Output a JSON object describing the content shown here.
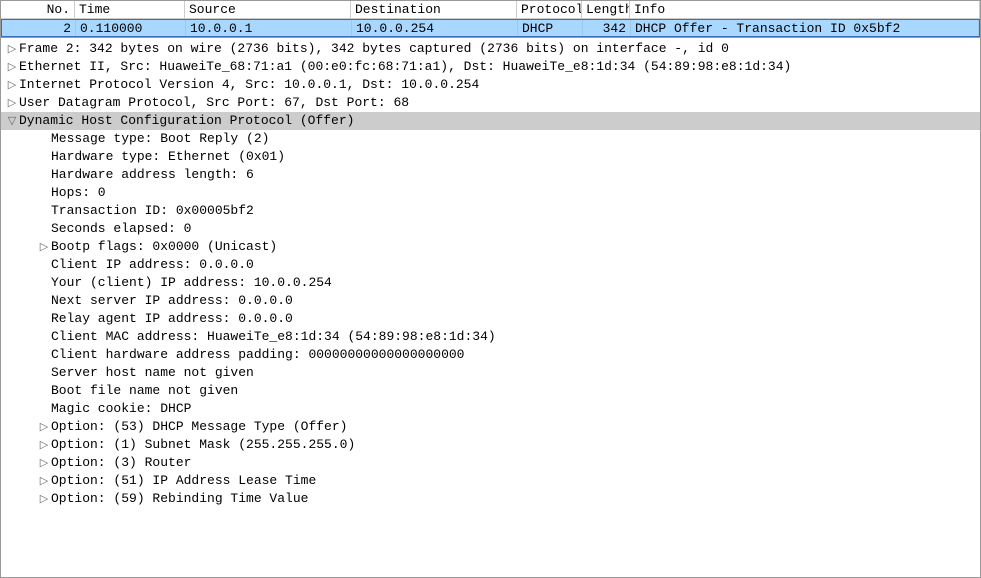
{
  "columns": {
    "no": "No.",
    "time": "Time",
    "src": "Source",
    "dst": "Destination",
    "proto": "Protocol",
    "len": "Length",
    "info": "Info"
  },
  "row": {
    "no": "2",
    "time": "0.110000",
    "src": "10.0.0.1",
    "dst": "10.0.0.254",
    "proto": "DHCP",
    "len": "342",
    "info": "DHCP Offer    - Transaction ID 0x5bf2"
  },
  "root": {
    "frame": "Frame 2: 342 bytes on wire (2736 bits), 342 bytes captured (2736 bits) on interface -, id 0",
    "eth": "Ethernet II, Src: HuaweiTe_68:71:a1 (00:e0:fc:68:71:a1), Dst: HuaweiTe_e8:1d:34 (54:89:98:e8:1d:34)",
    "ip": "Internet Protocol Version 4, Src: 10.0.0.1, Dst: 10.0.0.254",
    "udp": "User Datagram Protocol, Src Port: 67, Dst Port: 68",
    "dhcp": "Dynamic Host Configuration Protocol (Offer)"
  },
  "dhcp": {
    "msgtype": "Message type: Boot Reply (2)",
    "hwtype": "Hardware type: Ethernet (0x01)",
    "hwlen": "Hardware address length: 6",
    "hops": "Hops: 0",
    "xid": "Transaction ID: 0x00005bf2",
    "secs": "Seconds elapsed: 0",
    "flags": "Bootp flags: 0x0000 (Unicast)",
    "ciaddr": "Client IP address: 0.0.0.0",
    "yiaddr": "Your (client) IP address: 10.0.0.254",
    "siaddr": "Next server IP address: 0.0.0.0",
    "giaddr": "Relay agent IP address: 0.0.0.0",
    "chaddr": "Client MAC address: HuaweiTe_e8:1d:34 (54:89:98:e8:1d:34)",
    "chpad": "Client hardware address padding: 00000000000000000000",
    "sname": "Server host name not given",
    "bootfile": "Boot file name not given",
    "cookie": "Magic cookie: DHCP",
    "opt53": "Option: (53) DHCP Message Type (Offer)",
    "opt1": "Option: (1) Subnet Mask (255.255.255.0)",
    "opt3": "Option: (3) Router",
    "opt51": "Option: (51) IP Address Lease Time",
    "opt59": "Option: (59) Rebinding Time Value"
  }
}
